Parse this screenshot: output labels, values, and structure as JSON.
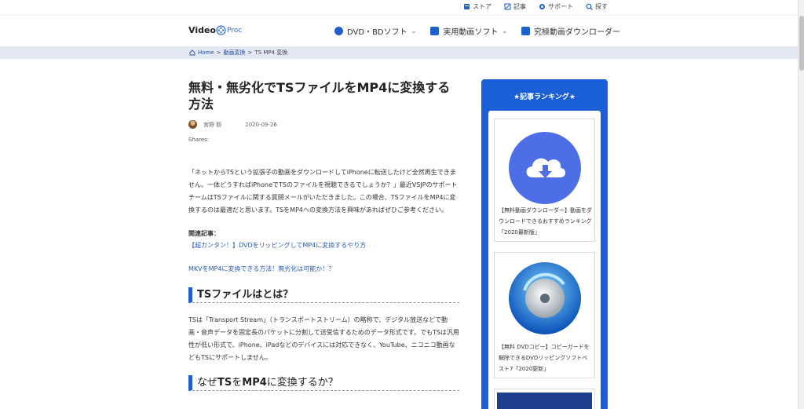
{
  "topbar": {
    "links": [
      {
        "label": "ストア",
        "icon": "store-icon"
      },
      {
        "label": "記事",
        "icon": "article-icon"
      },
      {
        "label": "サポート",
        "icon": "support-icon"
      },
      {
        "label": "探す",
        "icon": "search-icon"
      }
    ]
  },
  "header": {
    "logo_text": "Video",
    "logo_suffix": "Proc",
    "nav": [
      {
        "label": "DVD・BDソフト",
        "icon": "dvd-icon"
      },
      {
        "label": "実用動画ソフト",
        "icon": "video-icon"
      },
      {
        "label": "究極動画ダウンローダー",
        "icon": "download-icon"
      }
    ]
  },
  "breadcrumb": {
    "home": "Home",
    "sep": ">",
    "level1": "動画変換",
    "current": "TS MP4 変換"
  },
  "article": {
    "title": "無料・無劣化でTSファイルをMP4に変換する方法",
    "author": "宮野 毅",
    "date": "2020-09-26",
    "shares": "Shares:",
    "intro": "「ネットからTSという拡張子の動画をダウンロードしてiPhoneに転送したけど全然再生できません。一体どうすればiPhoneでTSのファイルを視聴できるでしょうか？」最近VSJPのサポートチームはTSファイルに関する質問メールがいただきました。この場合、TSファイルをMP4に変換するのは最適だと思います。TSをMP4への変換方法を興味があればぜひご参考ください。",
    "related_label": "関連記事：",
    "related_links": [
      "【超カンタン！】DVDをリッピングしてMP4に変換するやり方",
      "MKVをMP4に変換できる方法！無劣化は可能か！？"
    ],
    "h2_1": "TSファイルはとは？",
    "ts_desc": "TSは「Transport Stream」（トランスポートストリーム）の略称で、デジタル放送などで動画・音声データを固定長のパケットに分割して送受信するためのデータ形式です。でもTSは汎用性が低い形式で、iPhone、iPadなどのデバイスには対応できなく、YouTube、ニコニコ動画などもTSにサポートしません。",
    "h2_2_pre": "なぜ",
    "h2_2_b1": "TS",
    "h2_2_mid": "を",
    "h2_2_b2": "MP4",
    "h2_2_post": "に変換するか？"
  },
  "sidebar": {
    "title": "★記事ランキング★",
    "cards": [
      {
        "caption": "【無料動画ダウンローダー】動画をダウンロードできるおすすめランキング「2020最新版」",
        "icon": "cloud-download-icon"
      },
      {
        "caption": "【無料 DVDコピー】コピーガードを解除できるDVDリッピングソフトベスト7「2020更新」",
        "icon": "disc-icon"
      }
    ]
  },
  "colors": {
    "accent": "#1a5fd6",
    "link": "#2a5ab0",
    "breadcrumb_bg": "#e3e8f3"
  }
}
